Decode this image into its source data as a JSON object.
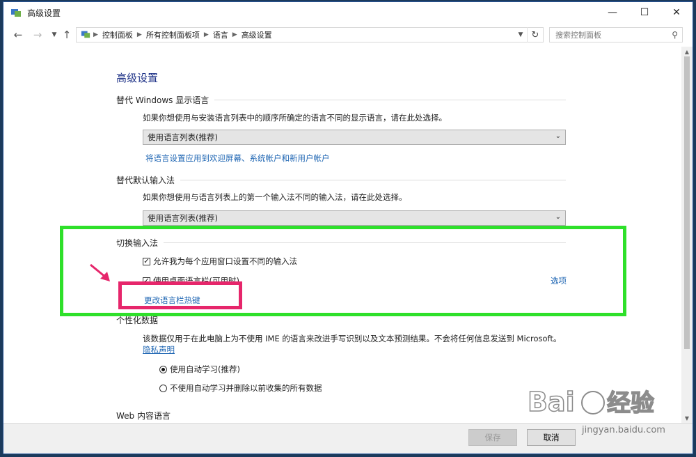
{
  "window": {
    "title": "高级设置"
  },
  "nav": {
    "breadcrumbs": [
      "控制面板",
      "所有控制面板项",
      "语言",
      "高级设置"
    ],
    "search_placeholder": "搜索控制面板"
  },
  "page": {
    "heading": "高级设置",
    "display_language": {
      "title": "替代 Windows 显示语言",
      "description": "如果你想使用与安装语言列表中的顺序所确定的语言不同的显示语言，请在此处选择。",
      "select_value": "使用语言列表(推荐)",
      "link": "将语言设置应用到欢迎屏幕、系统帐户和新用户帐户"
    },
    "default_input": {
      "title": "替代默认输入法",
      "description": "如果你想使用与语言列表上的第一个输入法不同的输入法，请在此处选择。",
      "select_value": "使用语言列表(推荐)"
    },
    "switch_input": {
      "title": "切换输入法",
      "checkbox1": "允许我为每个应用窗口设置不同的输入法",
      "checkbox2": "使用桌面语言栏(可用时)",
      "options_link": "选项",
      "hotkey_link": "更改语言栏热键"
    },
    "personalization": {
      "title_partial": "个性化数据",
      "description": "该数据仅用于在此电脑上为不使用 IME 的语言来改进手写识别以及文本预测结果。不会将任何信息发送到 Microsoft。",
      "privacy_link": "隐私声明",
      "radio1": "使用自动学习(推荐)",
      "radio2": "不使用自动学习并删除以前收集的所有数据"
    },
    "web_content": {
      "title": "Web 内容语言"
    }
  },
  "footer": {
    "save_label": "保存",
    "cancel_label": "取消"
  },
  "watermark": {
    "logo": "Baidu经验",
    "url": "jingyan.baidu.com"
  },
  "colors": {
    "highlight_green": "#2ee02a",
    "highlight_pink": "#e6266b",
    "link": "#1f66b3"
  }
}
